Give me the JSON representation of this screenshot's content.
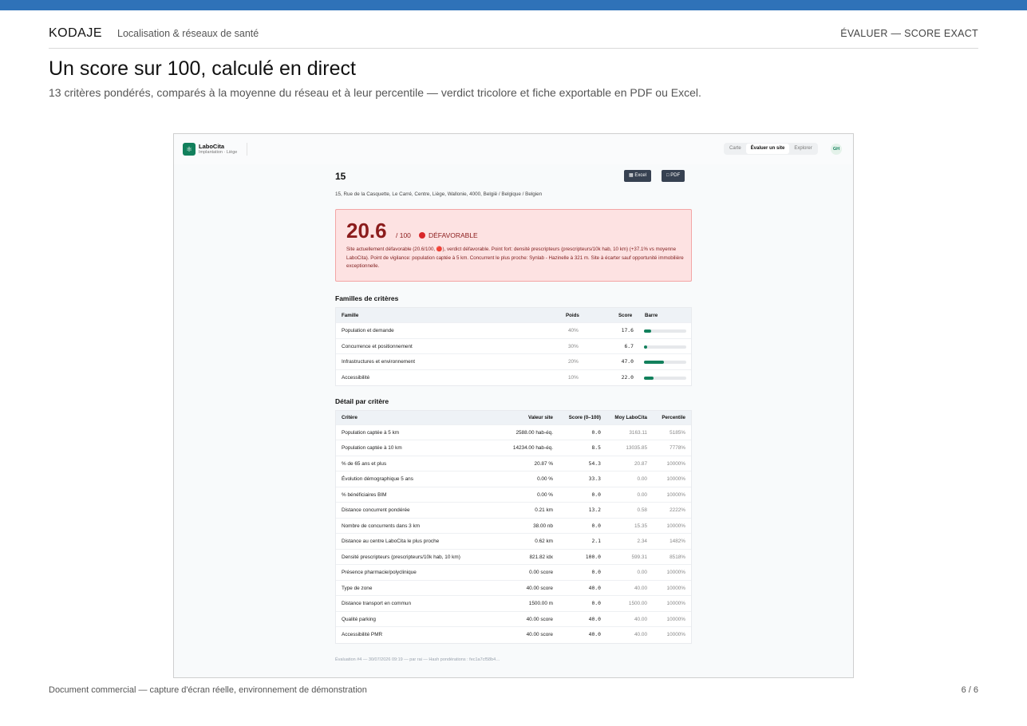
{
  "doc": {
    "brand": "KODAJE",
    "tagline": "Localisation & réseaux de santé",
    "section": "ÉVALUER — SCORE EXACT",
    "title": "Un score sur 100, calculé en direct",
    "subtitle": "13 critères pondérés, comparés à la moyenne du réseau et à leur percentile — verdict tricolore et fiche exportable en PDF ou Excel.",
    "footer": "Document commercial — capture d'écran réelle, environnement de démonstration",
    "page": "6 / 6"
  },
  "app": {
    "logo_icon": "flask-icon",
    "name": "LaboCita",
    "subtitle": "Implantation · Liège",
    "nav": [
      "Carte",
      "Évaluer un site",
      "Explorer"
    ],
    "avatar": "GH"
  },
  "site": {
    "title": "15",
    "address": "15, Rue de la Casquette, Le Carré, Centre, Liège, Wallonie, 4000, België / Belgique / Belgien",
    "excel_label": "Excel",
    "pdf_label": "PDF"
  },
  "verdict": {
    "score": "20.6",
    "max": "/ 100",
    "label": "DÉFAVORABLE",
    "color": "#d9262a",
    "text": "Site actuellement défavorable (20.6/100, 🔴), verdict défavorable. Point fort: densité prescripteurs (prescripteurs/10k hab, 10 km) (+37.1% vs moyenne LaboCita). Point de vigilance: population captée à 5 km. Concurrent le plus proche: Synlab - Hazinelle à 321 m. Site à écarter sauf opportunité immobilière exceptionnelle."
  },
  "families": {
    "heading": "Familles de critères",
    "headers": [
      "Famille",
      "Poids",
      "Score",
      "Barre"
    ],
    "rows": [
      {
        "name": "Population et demande",
        "weight": "40%",
        "score": "17.6",
        "bar": 17.6
      },
      {
        "name": "Concurrence et positionnement",
        "weight": "30%",
        "score": "6.7",
        "bar": 6.7
      },
      {
        "name": "Infrastructures et environnement",
        "weight": "20%",
        "score": "47.0",
        "bar": 47.0
      },
      {
        "name": "Accessibilité",
        "weight": "10%",
        "score": "22.0",
        "bar": 22.0
      }
    ]
  },
  "details": {
    "heading": "Détail par critère",
    "headers": [
      "Critère",
      "Valeur site",
      "Score (0–100)",
      "Moy LaboCita",
      "Percentile"
    ],
    "rows": [
      {
        "name": "Population captée à 5 km",
        "value": "2588.00 hab-éq.",
        "score": "0.0",
        "avg": "3163.11",
        "pct": "5185%"
      },
      {
        "name": "Population captée à 10 km",
        "value": "14234.00 hab-éq.",
        "score": "8.5",
        "avg": "13035.85",
        "pct": "7778%"
      },
      {
        "name": "% de 65 ans et plus",
        "value": "20.87 %",
        "score": "54.3",
        "avg": "20.87",
        "pct": "10000%"
      },
      {
        "name": "Évolution démographique 5 ans",
        "value": "0.00 %",
        "score": "33.3",
        "avg": "0.00",
        "pct": "10000%"
      },
      {
        "name": "% bénéficiaires BIM",
        "value": "0.00 %",
        "score": "0.0",
        "avg": "0.00",
        "pct": "10000%"
      },
      {
        "name": "Distance concurrent pondérée",
        "value": "0.21 km",
        "score": "13.2",
        "avg": "0.58",
        "pct": "2222%"
      },
      {
        "name": "Nombre de concurrents dans 3 km",
        "value": "38.00 nb",
        "score": "0.0",
        "avg": "15.35",
        "pct": "10000%"
      },
      {
        "name": "Distance au centre LaboCita le plus proche",
        "value": "0.62 km",
        "score": "2.1",
        "avg": "2.34",
        "pct": "1482%"
      },
      {
        "name": "Densité prescripteurs (prescripteurs/10k hab, 10 km)",
        "value": "821.82 idx",
        "score": "100.0",
        "avg": "599.31",
        "pct": "8518%"
      },
      {
        "name": "Présence pharmacie/polyclinique",
        "value": "0.00 score",
        "score": "0.0",
        "avg": "0.00",
        "pct": "10000%"
      },
      {
        "name": "Type de zone",
        "value": "40.00 score",
        "score": "40.0",
        "avg": "40.00",
        "pct": "10000%"
      },
      {
        "name": "Distance transport en commun",
        "value": "1500.00 m",
        "score": "0.0",
        "avg": "1500.00",
        "pct": "10000%"
      },
      {
        "name": "Qualité parking",
        "value": "40.00 score",
        "score": "40.0",
        "avg": "40.00",
        "pct": "10000%"
      },
      {
        "name": "Accessibilité PMR",
        "value": "40.00 score",
        "score": "40.0",
        "avg": "40.00",
        "pct": "10000%"
      }
    ]
  },
  "evaluation_footer": "Évaluation #4 — 30/07/2026 09:19 — par rai — Hash pondérations : fec1a7cf58b4…"
}
